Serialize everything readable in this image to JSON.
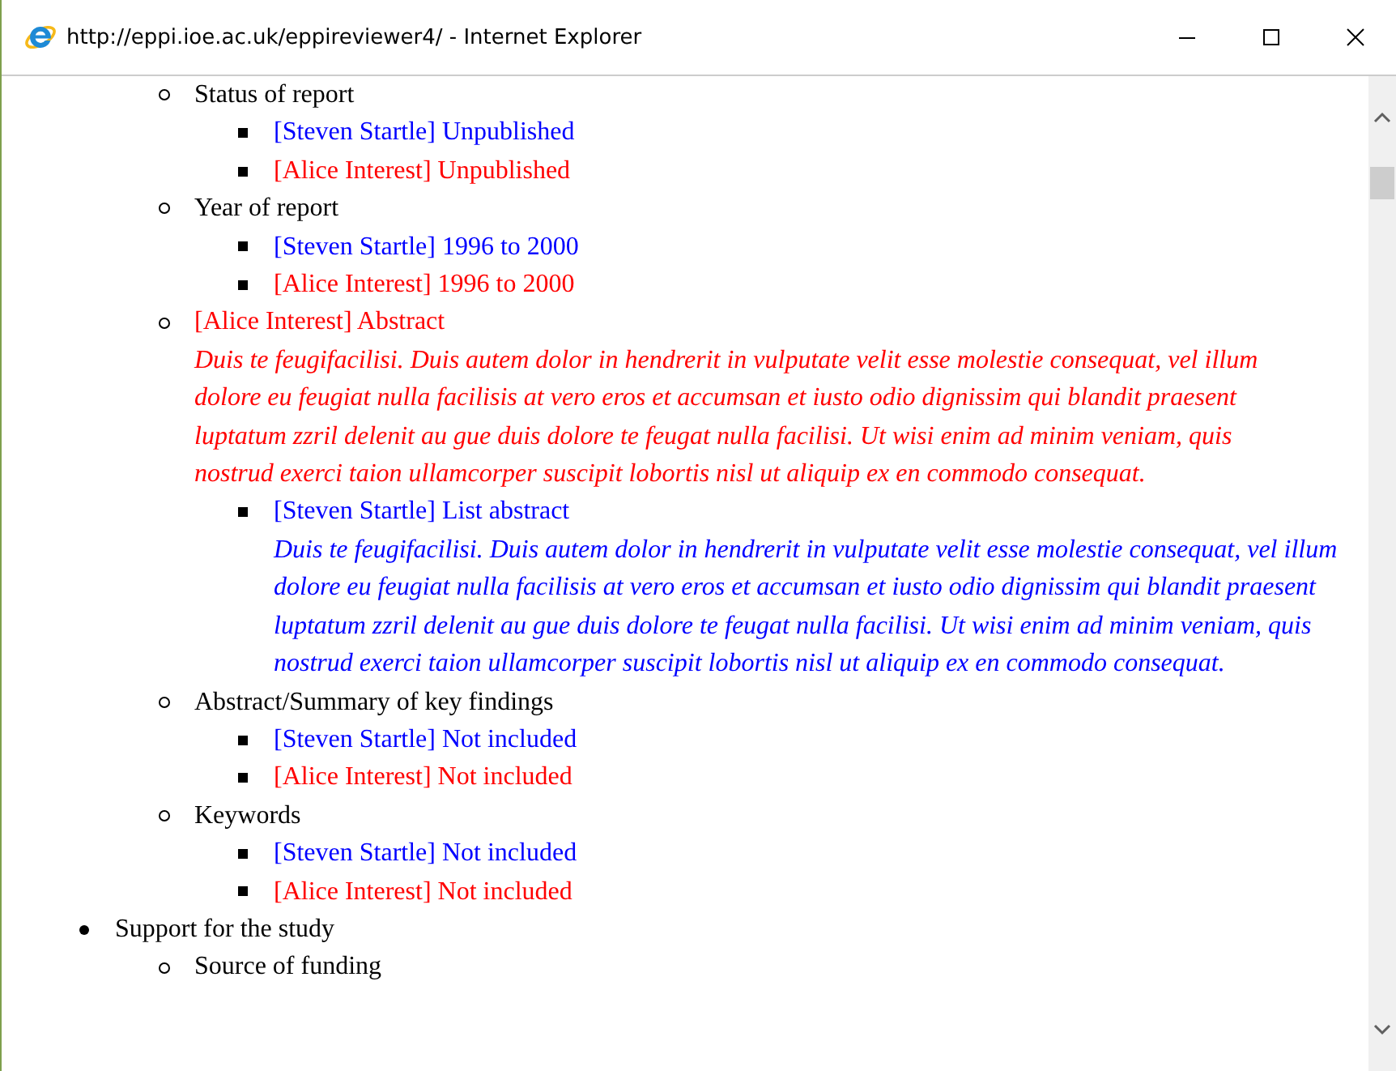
{
  "window": {
    "title": "http://eppi.ioe.ac.uk/eppireviewer4/ - Internet Explorer"
  },
  "outline": [
    {
      "children": [
        {
          "text": "Status of report",
          "children": [
            {
              "text": "[Steven Startle] Unpublished",
              "color": "#0000ff"
            },
            {
              "text": "[Alice Interest] Unpublished",
              "color": "#ff0000"
            }
          ]
        },
        {
          "text": "Year of report",
          "children": [
            {
              "text": "[Steven Startle] 1996 to 2000",
              "color": "#0000ff"
            },
            {
              "text": "[Alice Interest] 1996 to 2000",
              "color": "#ff0000"
            }
          ]
        },
        {
          "text": "[Alice Interest] Abstract",
          "color": "#ff0000",
          "note": "Duis te feugifacilisi. Duis autem dolor in hendrerit in vulputate velit esse molestie consequat, vel illum dolore eu feugiat nulla facilisis at vero eros et accumsan et iusto odio dignissim qui blandit praesent luptatum zzril delenit au gue duis dolore te feugat nulla facilisi. Ut wisi enim ad minim veniam, quis nostrud exerci taion ullamcorper suscipit lobortis nisl ut aliquip ex en commodo consequat.",
          "children": [
            {
              "text": "[Steven Startle] List abstract",
              "color": "#0000ff",
              "note": "Duis te feugifacilisi. Duis autem dolor in hendrerit in vulputate velit esse molestie consequat, vel illum dolore eu feugiat nulla facilisis at vero eros et accumsan et iusto odio dignissim qui blandit praesent luptatum zzril delenit au gue duis dolore te feugat nulla facilisi. Ut wisi enim ad minim veniam, quis nostrud exerci taion ullamcorper suscipit lobortis nisl ut aliquip ex en commodo consequat."
            }
          ]
        },
        {
          "text": "Abstract/Summary of key findings",
          "children": [
            {
              "text": "[Steven Startle] Not included",
              "color": "#0000ff"
            },
            {
              "text": "[Alice Interest] Not included",
              "color": "#ff0000"
            }
          ]
        },
        {
          "text": "Keywords",
          "children": [
            {
              "text": "[Steven Startle] Not included",
              "color": "#0000ff"
            },
            {
              "text": "[Alice Interest] Not included",
              "color": "#ff0000"
            }
          ]
        }
      ]
    },
    {
      "text": "Support for the study",
      "children": [
        {
          "text": "Source of funding"
        }
      ]
    }
  ]
}
